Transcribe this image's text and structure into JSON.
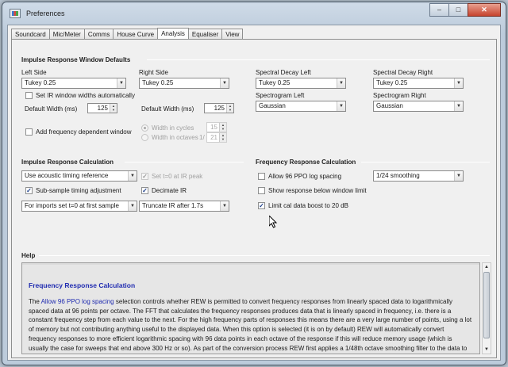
{
  "window": {
    "title": "Preferences",
    "min": "–",
    "max": "□",
    "close": "✕"
  },
  "tabs": [
    "Soundcard",
    "Mic/Meter",
    "Comms",
    "House Curve",
    "Analysis",
    "Equaliser",
    "View"
  ],
  "irw": {
    "title": "Impulse Response Window Defaults",
    "left_label": "Left Side",
    "left_value": "Tukey 0.25",
    "right_label": "Right Side",
    "right_value": "Tukey 0.25",
    "sdl_label": "Spectral Decay Left",
    "sdl_value": "Tukey 0.25",
    "sdr_label": "Spectral Decay Right",
    "sdr_value": "Tukey 0.25",
    "set_ir_label": "Set IR window widths automatically",
    "spl_label": "Spectrogram Left",
    "spl_value": "Gaussian",
    "spr_label": "Spectrogram Right",
    "spr_value": "Gaussian",
    "dw_left_label": "Default Width (ms)",
    "dw_left_value": "125",
    "dw_right_label": "Default Width (ms)",
    "dw_right_value": "125",
    "freq_dep_label": "Add frequency dependent window",
    "cycles_label": "Width in cycles",
    "cycles_value": "15",
    "octaves_label": "Width in octaves",
    "octaves_prefix": "1/",
    "octaves_value": "21"
  },
  "irc": {
    "title": "Impulse Response Calculation",
    "timing_value": "Use acoustic timing reference",
    "set_t0_label": "Set t=0 at IR peak",
    "subsample_label": "Sub-sample timing adjustment",
    "decimate_label": "Decimate IR",
    "imports_value": "For imports set t=0 at first sample",
    "truncate_value": "Truncate IR after 1.7s"
  },
  "frc": {
    "title": "Frequency Response Calculation",
    "allow96_label": "Allow 96 PPO log spacing",
    "smoothing_value": "1/24 smoothing",
    "show_below_label": "Show response below window limit",
    "limit_cal_label": "Limit cal data boost to 20 dB"
  },
  "help": {
    "title": "Help",
    "heading": "Frequency Response Calculation",
    "p_prefix": "The ",
    "p_link": "Allow 96 PPO log spacing",
    "p_body": " selection controls whether REW is permitted to convert frequency responses from linearly spaced data to logarithmically spaced data at 96 points per octave. The FFT that calculates the frequency responses produces data that is linearly spaced in frequency, i.e. there is a constant frequency step from each value to the next. For the high frequency parts of responses this means there are a very large number of points, using a lot of memory but not contributing anything useful to the displayed data. When this option is selected (it is on by default) REW will automatically convert frequency responses to more efficient logarithmic spacing with 96 data points in each octave of the response if this will reduce memory usage (which is usually the case for sweeps that end above 300 Hz or so). As part of the conversion process REW first applies a 1/48th octave smoothing filter to the data to remove any high frequency combing from the response. The conversion takes place on any new measurement or when an IR Window is applied. Whether a measurement is log spaced or linearly spaced"
  },
  "glyphs": {
    "check": "✓",
    "down": "▼",
    "up": "▲"
  },
  "colors": {
    "link": "#1f2bb0",
    "titlebar": "#bccbdb",
    "help_bg": "#e6e6e6"
  }
}
